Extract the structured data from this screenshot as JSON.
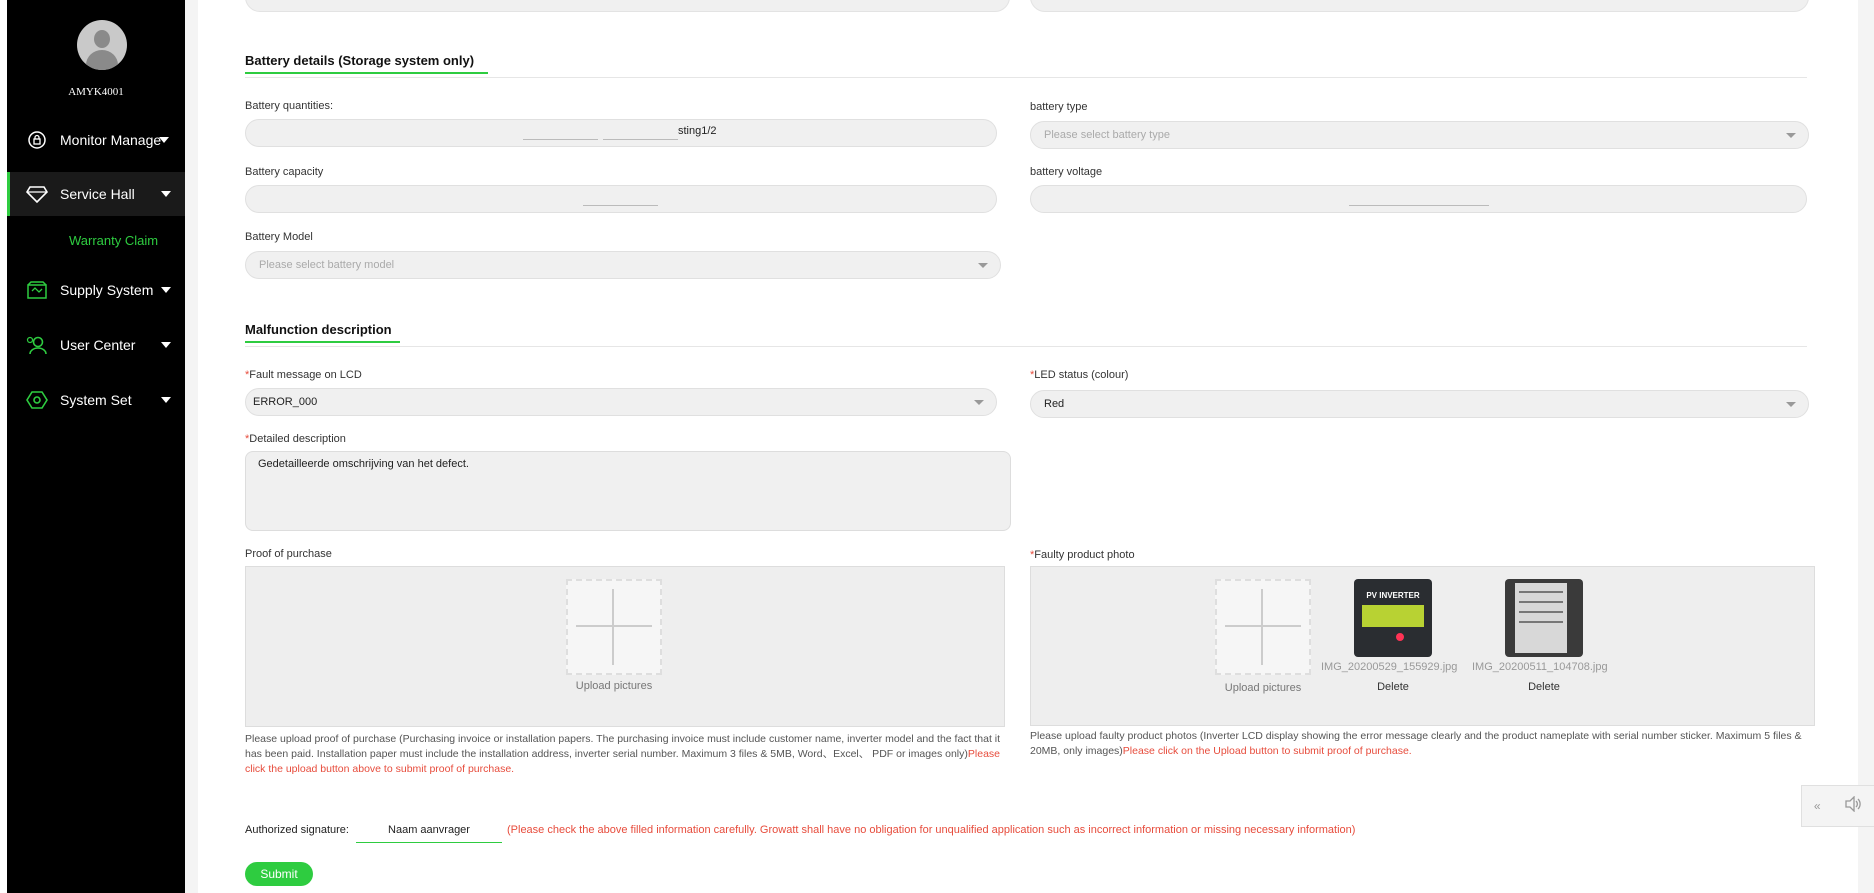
{
  "user": {
    "name": "AMYK4001"
  },
  "sidebar": {
    "items": [
      {
        "label": "Monitor Manage",
        "icon": "monitor-icon"
      },
      {
        "label": "Service Hall",
        "icon": "diamond-icon",
        "sub": "Warranty Claim"
      },
      {
        "label": "Supply System",
        "icon": "store-icon"
      },
      {
        "label": "User Center",
        "icon": "user-settings-icon"
      },
      {
        "label": "System Set",
        "icon": "gear-icon"
      }
    ]
  },
  "battery": {
    "title": "Battery details (Storage system only)",
    "quantities_label": "Battery quantities:",
    "quantities_suffix": "sting1/2",
    "type_label": "battery type",
    "type_placeholder": "Please select battery type",
    "capacity_label": "Battery capacity",
    "voltage_label": "battery voltage",
    "model_label": "Battery Model",
    "model_placeholder": "Please select battery model"
  },
  "malfunction": {
    "title": "Malfunction description",
    "fault_label": "Fault message on LCD",
    "fault_value": "ERROR_000",
    "led_label": "LED status (colour)",
    "led_value": "Red",
    "desc_label": "Detailed description",
    "desc_value": "Gedetailleerde omschrijving van het defect.",
    "required_mark": "*"
  },
  "purchase": {
    "label": "Proof of purchase",
    "upload_caption": "Upload pictures",
    "help": "Please upload proof of purchase (Purchasing invoice or installation papers. The purchasing invoice must include customer name, inverter model and the fact that it has been paid. Installation paper must include the installation address, inverter serial number. Maximum 3 files & 5MB, Word、Excel、 PDF or images only)",
    "help_red": "Please click the upload button above to submit proof of purchase."
  },
  "photo": {
    "label": "Faulty product photo",
    "upload_caption": "Upload pictures",
    "files": [
      {
        "name": "IMG_20200529_155929.jpg",
        "delete": "Delete",
        "thumb_text": "PV INVERTER"
      },
      {
        "name": "IMG_20200511_104708.jpg",
        "delete": "Delete"
      }
    ],
    "help": "Please upload faulty product photos (Inverter LCD display showing the error message clearly and the product nameplate with serial number sticker. Maximum 5 files & 20MB, only images)",
    "help_red": "Please click on the Upload button to submit proof of purchase."
  },
  "signature": {
    "label": "Authorized signature:",
    "value": "Naam aanvrager",
    "note": "(Please check the above filled information carefully. Growatt shall have no obligation for unqualified application such as incorrect information or missing necessary information)"
  },
  "submit_label": "Submit",
  "colors": {
    "accent": "#2ecc40",
    "required": "#e74c3c",
    "sidebar": "#000000"
  }
}
